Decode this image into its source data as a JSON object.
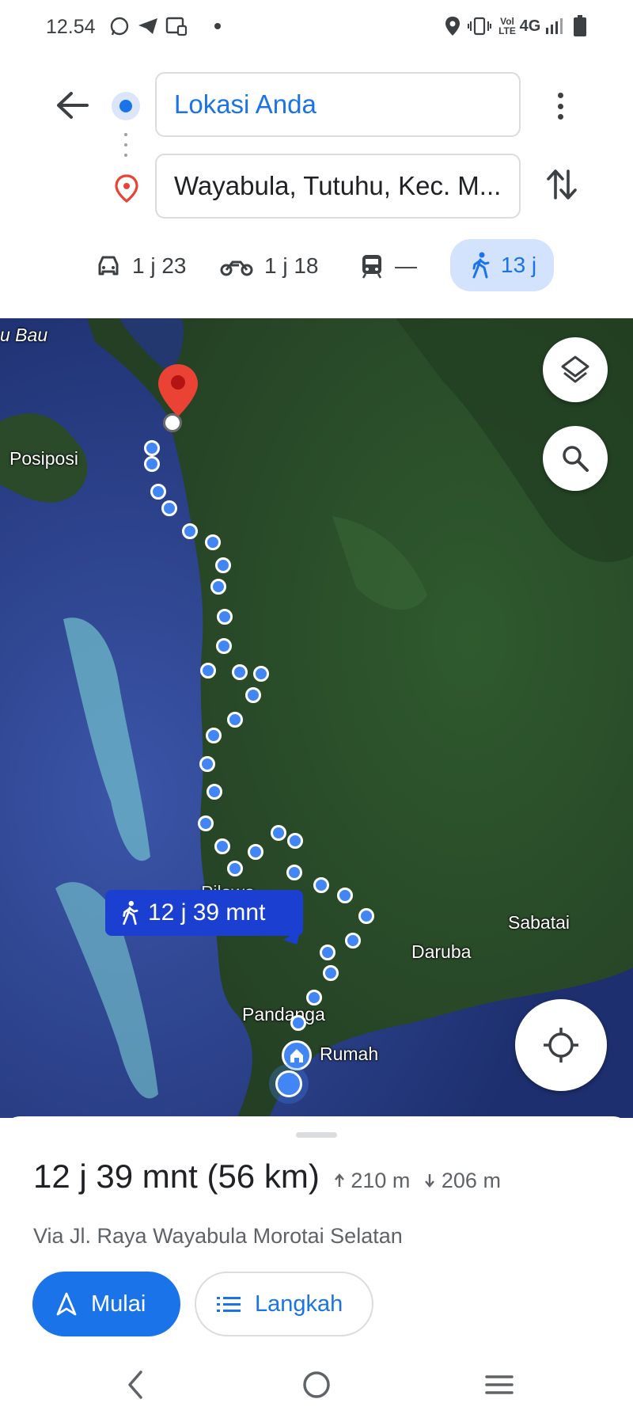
{
  "status_bar": {
    "time": "12.54",
    "network": "4G",
    "icons": [
      "whatsapp-icon",
      "telegram-icon",
      "cast-icon",
      "dot-icon",
      "location-icon",
      "vibrate-icon",
      "volte-icon",
      "signal-icon",
      "battery-icon"
    ]
  },
  "header": {
    "origin": "Lokasi Anda",
    "destination": "Wayabula, Tutuhu, Kec. M..."
  },
  "modes": [
    {
      "name": "car",
      "label": "1 j 23"
    },
    {
      "name": "motorcycle",
      "label": "1 j 18"
    },
    {
      "name": "transit",
      "label": "—"
    },
    {
      "name": "walk",
      "label": "13 j",
      "selected": true
    }
  ],
  "map": {
    "places": {
      "bau": "u Bau",
      "posiposi": "Posiposi",
      "sabatai": "Sabatai",
      "daruba": "Daruba",
      "rumah": "Rumah",
      "pandanga": "Pandanga",
      "pilowo": "Pilowo"
    },
    "route_label": "12 j 39 mnt",
    "colors": {
      "route": "#4285f4",
      "pin": "#ea4335",
      "label_bg": "#1a3fd1"
    }
  },
  "sheet": {
    "duration": "12 j 39 mnt (56 km)",
    "ascent": "210 m",
    "descent": "206 m",
    "via": "Via Jl. Raya Wayabula Morotai Selatan",
    "start_label": "Mulai",
    "steps_label": "Langkah"
  },
  "colors": {
    "accent": "#1a73e8",
    "selected_mode_bg": "#d3e3fd"
  }
}
